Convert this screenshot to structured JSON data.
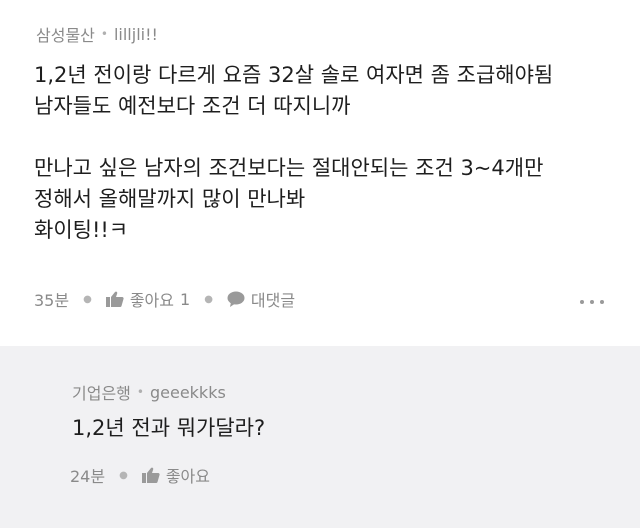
{
  "comment": {
    "author_group": "삼성물산",
    "author_id": "lilljli!!",
    "body": "1,2년 전이랑 다르게 요즘 32살 솔로 여자면 좀 조급해야됨\n남자들도 예전보다 조건 더 따지니까\n\n만나고 싶은 남자의 조건보다는 절대안되는 조건 3~4개만\n정해서 올해말까지 많이 만나봐\n화이팅!!ㅋ",
    "time": "35분",
    "like_label": "좋아요",
    "like_count": "1",
    "reply_label": "대댓글"
  },
  "reply": {
    "author_group": "기업은행",
    "author_id": "geeekkks",
    "body": "1,2년 전과 뭐가달라?",
    "time": "24분",
    "like_label": "좋아요"
  },
  "icons": {
    "like": "thumbs-up-icon",
    "reply": "speech-bubble-icon",
    "more": "more-dots-icon"
  },
  "colors": {
    "reply_background": "#f1f1f3",
    "meta_text": "#8a8a8a",
    "body_text": "#1e1e1e"
  }
}
